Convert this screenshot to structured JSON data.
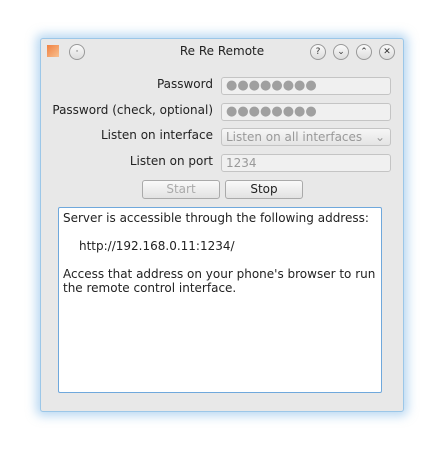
{
  "window": {
    "title": "Re Re Remote"
  },
  "form": {
    "password_label": "Password",
    "password_value": "●●●●●●●●",
    "password_check_label": "Password (check, optional)",
    "password_check_value": "●●●●●●●●",
    "interface_label": "Listen on interface",
    "interface_value": "Listen on all interfaces",
    "port_label": "Listen on port",
    "port_placeholder": "1234"
  },
  "buttons": {
    "start": "Start",
    "stop": "Stop"
  },
  "output": {
    "line1": "Server is accessible through the following address:",
    "address": "http://192.168.0.11:1234/",
    "line3": "Access that address on your phone's browser to run the remote control interface."
  }
}
